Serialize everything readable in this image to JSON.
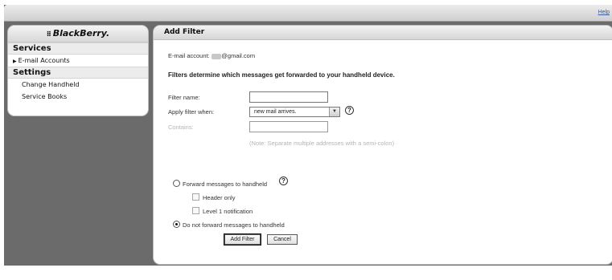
{
  "header": {
    "help_label": "Help"
  },
  "sidebar": {
    "logo_text": "BlackBerry.",
    "services_heading": "Services",
    "email_accounts_label": "E-mail Accounts",
    "settings_heading": "Settings",
    "change_handheld_label": "Change Handheld",
    "service_books_label": "Service Books"
  },
  "main": {
    "title": "Add Filter",
    "email_account_label": "E-mail account:",
    "email_account_masked": "•••••",
    "email_account_domain": "@gmail.com",
    "description": "Filters determine which messages get forwarded to your handheld device.",
    "filter_name_label": "Filter name:",
    "filter_name_value": "",
    "apply_when_label": "Apply filter when:",
    "apply_when_selected": "new mail arrives.",
    "contains_label": "Contains:",
    "contains_value": "",
    "contains_note": "(Note: Separate multiple addresses with a semi-colon)",
    "forward_label": "Forward messages to handheld",
    "header_only_label": "Header only",
    "level1_label": "Level 1 notification",
    "do_not_forward_label": "Do not forward messages to handheld",
    "add_filter_button": "Add Filter",
    "cancel_button": "Cancel",
    "forward_selected": false,
    "do_not_forward_selected": true,
    "header_only_checked": false,
    "level1_checked": false
  },
  "icons": {
    "help": "help-circle-icon",
    "dropdown": "chevron-down-icon",
    "bullet": "triangle-right-icon",
    "logo": "blackberry-logo-icon"
  },
  "colors": {
    "frame": "#6b6b6b",
    "link": "#3a5a9a",
    "disabled_text": "#b4b4b4"
  }
}
